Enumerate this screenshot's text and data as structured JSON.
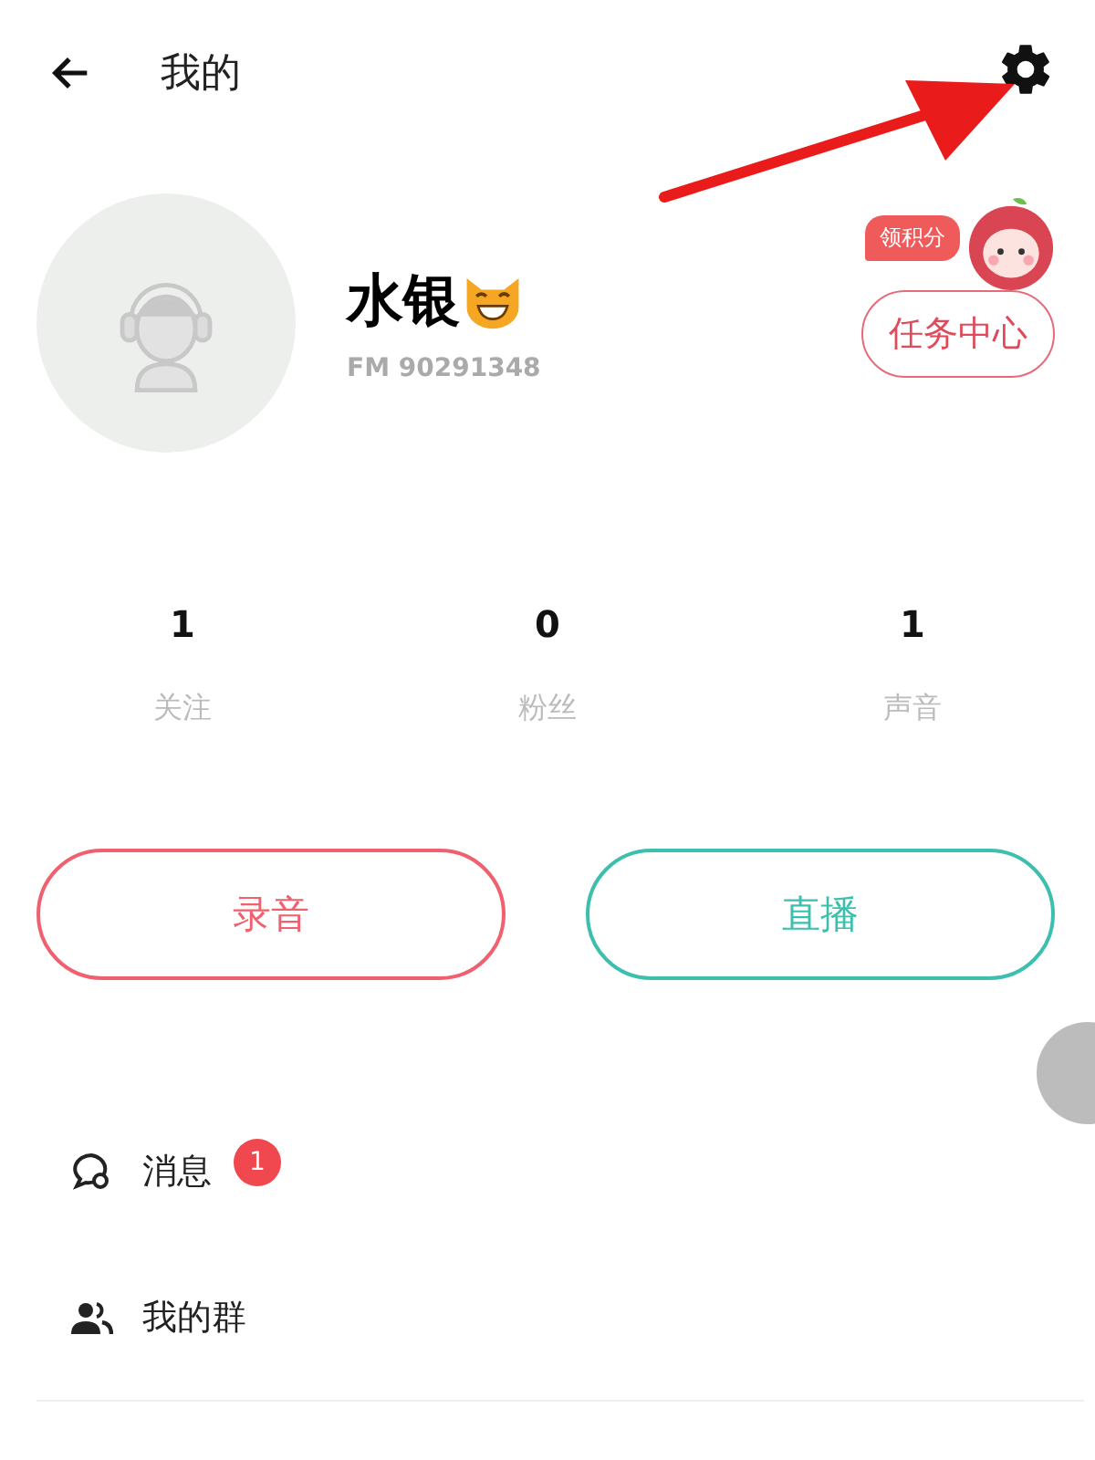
{
  "header": {
    "title": "我的"
  },
  "profile": {
    "name": "水银",
    "id_text": "FM 90291348",
    "points_bubble": "领积分",
    "task_button": "任务中心"
  },
  "stats": [
    {
      "value": "1",
      "label": "关注"
    },
    {
      "value": "0",
      "label": "粉丝"
    },
    {
      "value": "1",
      "label": "声音"
    }
  ],
  "actions": [
    {
      "label": "录音",
      "color": "#f0606e"
    },
    {
      "label": "直播",
      "color": "#3dbfae"
    }
  ],
  "menu": [
    {
      "kind": "message",
      "label": "消息",
      "badge": "1"
    },
    {
      "kind": "group",
      "label": "我的群"
    }
  ]
}
